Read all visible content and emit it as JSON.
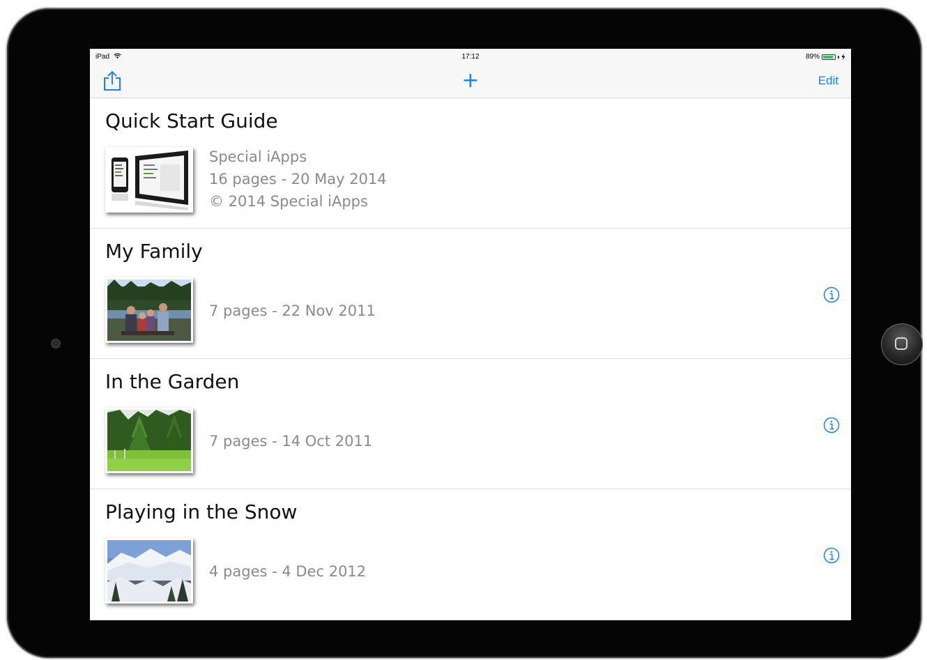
{
  "status": {
    "device": "iPad",
    "time": "17:12",
    "battery": "89%",
    "battery_level": 0.89
  },
  "nav": {
    "share_icon": "share-icon",
    "add_label": "+",
    "edit_label": "Edit"
  },
  "books": [
    {
      "title": "Quick Start Guide",
      "lines": [
        "Special iApps",
        "16 pages - 20 May 2014",
        "© 2014 Special iApps"
      ],
      "has_info": false
    },
    {
      "title": "My Family",
      "lines": [
        "7 pages - 22 Nov 2011"
      ],
      "has_info": true
    },
    {
      "title": "In the Garden",
      "lines": [
        "7 pages - 14 Oct 2011"
      ],
      "has_info": true
    },
    {
      "title": "Playing in the Snow",
      "lines": [
        "4 pages - 4 Dec 2012"
      ],
      "has_info": true
    }
  ],
  "colors": {
    "accent": "#1a82f7"
  }
}
